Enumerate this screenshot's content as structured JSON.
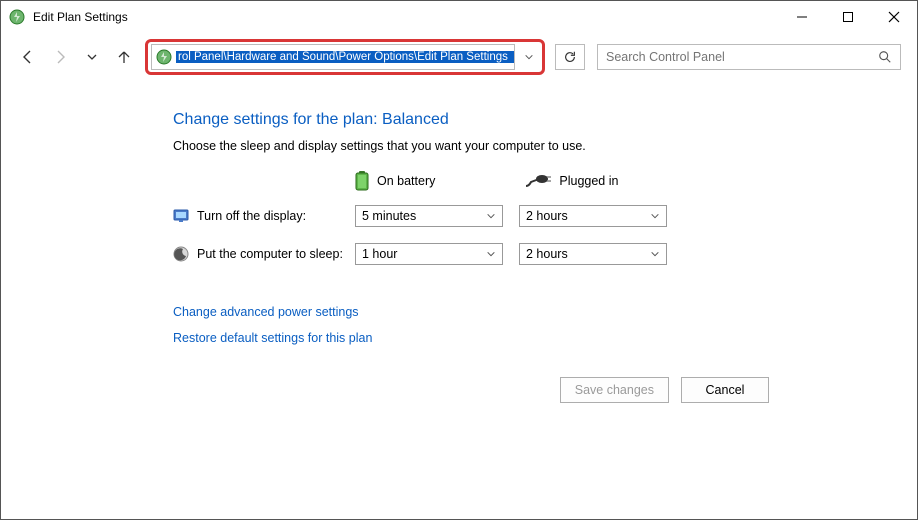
{
  "window": {
    "title": "Edit Plan Settings"
  },
  "address": {
    "path": "rol Panel\\Hardware and Sound\\Power Options\\Edit Plan Settings"
  },
  "search": {
    "placeholder": "Search Control Panel"
  },
  "page": {
    "heading": "Change settings for the plan: Balanced",
    "subtext": "Choose the sleep and display settings that you want your computer to use.",
    "col_battery": "On battery",
    "col_plugged": "Plugged in",
    "row_display_label": "Turn off the display:",
    "row_display_battery": "5 minutes",
    "row_display_plugged": "2 hours",
    "row_sleep_label": "Put the computer to sleep:",
    "row_sleep_battery": "1 hour",
    "row_sleep_plugged": "2 hours",
    "link_advanced": "Change advanced power settings",
    "link_restore": "Restore default settings for this plan"
  },
  "buttons": {
    "save": "Save changes",
    "cancel": "Cancel"
  }
}
